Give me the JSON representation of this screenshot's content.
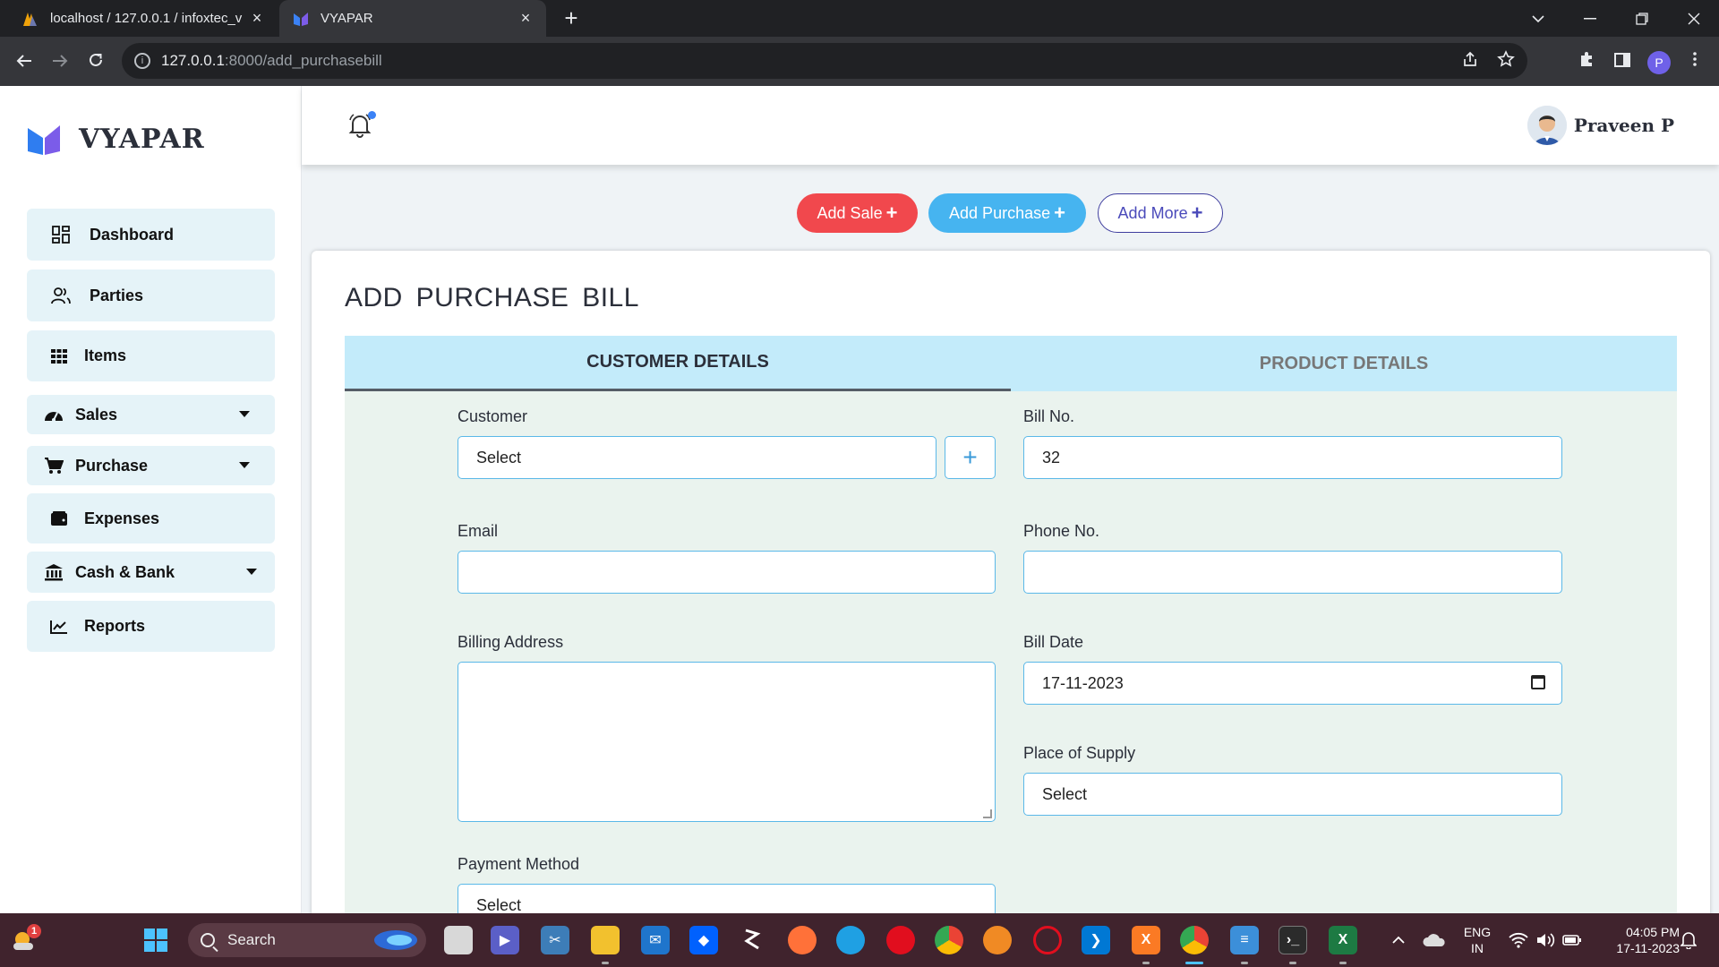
{
  "browser": {
    "tabs": [
      {
        "title": "localhost / 127.0.0.1 / infoxtec_v",
        "close": "×"
      },
      {
        "title": "VYAPAR",
        "close": "×"
      }
    ],
    "new_tab": "+",
    "url_host": "127.0.0.1",
    "url_path": ":8000/add_purchasebill",
    "profile_initial": "P"
  },
  "app": {
    "logo_text": "VYAPAR",
    "user_name": "Praveen P",
    "accent_color": "#2a7be4"
  },
  "sidebar": {
    "items": [
      {
        "label": "Dashboard",
        "icon": "dashboard-icon",
        "has_caret": false
      },
      {
        "label": "Parties",
        "icon": "users-icon",
        "has_caret": false
      },
      {
        "label": "Items",
        "icon": "grid-icon",
        "has_caret": false
      },
      {
        "label": "Sales",
        "icon": "speedometer-icon",
        "has_caret": true
      },
      {
        "label": "Purchase",
        "icon": "cart-icon",
        "has_caret": true
      },
      {
        "label": "Expenses",
        "icon": "wallet-icon",
        "has_caret": false
      },
      {
        "label": "Cash & Bank",
        "icon": "bank-icon",
        "has_caret": true
      },
      {
        "label": "Reports",
        "icon": "chart-line-icon",
        "has_caret": false
      }
    ]
  },
  "quick_actions": {
    "add_sale": "Add Sale",
    "add_purchase": "Add Purchase",
    "add_more": "Add More",
    "plus": "+"
  },
  "page": {
    "title": "ADD PURCHASE BILL",
    "tabs": {
      "customer": "CUSTOMER DETAILS",
      "product": "PRODUCT DETAILS"
    }
  },
  "form": {
    "customer": {
      "label": "Customer",
      "value": "Select"
    },
    "add_customer": "+",
    "bill_no": {
      "label": "Bill No.",
      "value": "32"
    },
    "email": {
      "label": "Email",
      "value": ""
    },
    "phone": {
      "label": "Phone No.",
      "value": ""
    },
    "billing_address": {
      "label": "Billing Address",
      "value": ""
    },
    "bill_date": {
      "label": "Bill Date",
      "value": "17-11-2023"
    },
    "place_of_supply": {
      "label": "Place of Supply",
      "value": "Select"
    },
    "payment_method": {
      "label": "Payment Method",
      "value": "Select"
    }
  },
  "taskbar": {
    "search_label": "Search",
    "notification_badge": "1",
    "language": "ENG",
    "region": "IN",
    "time": "04:05 PM",
    "date": "17-11-2023"
  }
}
